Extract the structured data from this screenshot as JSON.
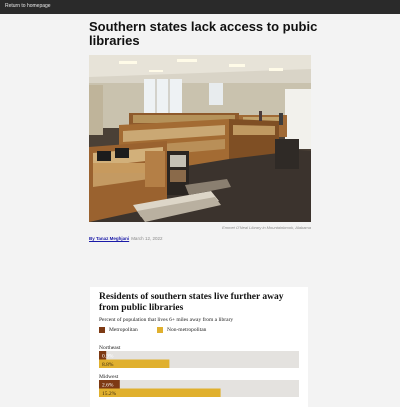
{
  "nav": {
    "home_link": "Return to homepage"
  },
  "article": {
    "headline": "Southern states lack access to pubic libraries",
    "photo_caption": "Emmet O'Neal Library in Mountainbrook, Alabama",
    "author": "By Tanaz Meghjani",
    "date": "March 12, 2022"
  },
  "colors": {
    "metropolitan": "#7d3a14",
    "non_metropolitan": "#e0b02e",
    "track": "#e4e2df",
    "topbar": "#2a2a2a"
  },
  "chart_data": {
    "type": "bar",
    "title": "Residents of southern states live further away from public libraries",
    "subtitle": "Percent of population that lives 6+ miles away from a library",
    "legend": [
      "Metropolitan",
      "Non-metropolitan"
    ],
    "categories": [
      "Northeast",
      "Midwest"
    ],
    "series": [
      {
        "name": "Metropolitan",
        "values": [
          0.9,
          2.6
        ],
        "labels": [
          "0.9%",
          "2.6%"
        ]
      },
      {
        "name": "Non-metropolitan",
        "values": [
          8.8,
          15.2
        ],
        "labels": [
          "8.8%",
          "15.2%"
        ]
      }
    ],
    "xlim": [
      0,
      25
    ]
  }
}
